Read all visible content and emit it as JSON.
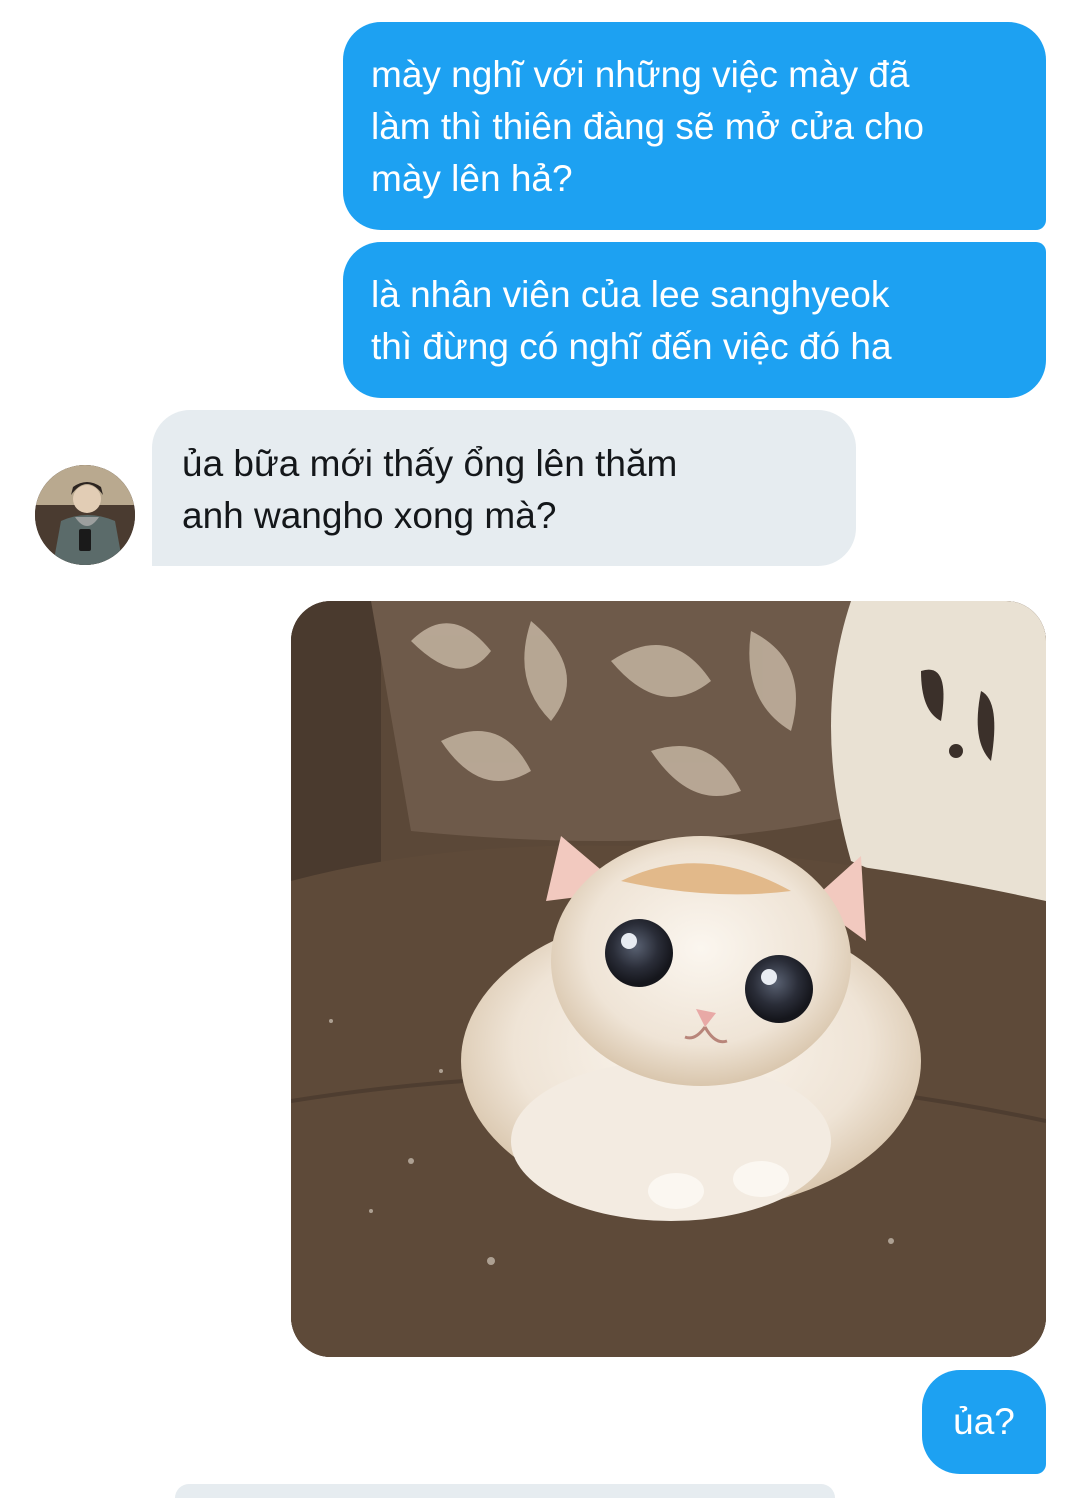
{
  "conversation": {
    "messages": [
      {
        "direction": "sent",
        "text": "mày nghĩ với những việc mày đã\nlàm thì thiên đàng sẽ mở cửa cho\nmày lên hả?"
      },
      {
        "direction": "sent",
        "text": "là nhân viên của lee sanghyeok\nthì đừng có nghĩ đến việc đó ha"
      },
      {
        "direction": "received",
        "text": "ủa bữa mới thấy ổng lên thăm\nanh wangho xong mà?"
      },
      {
        "direction": "sent",
        "type": "image",
        "image": "kitten-photo"
      },
      {
        "direction": "sent",
        "text": "ủa?"
      }
    ]
  },
  "colors": {
    "sent_bubble": "#1da1f2",
    "received_bubble": "#e6ecf0",
    "sent_text": "#ffffff",
    "received_text": "#14171a"
  },
  "icons": {
    "avatar": "contact-avatar"
  }
}
